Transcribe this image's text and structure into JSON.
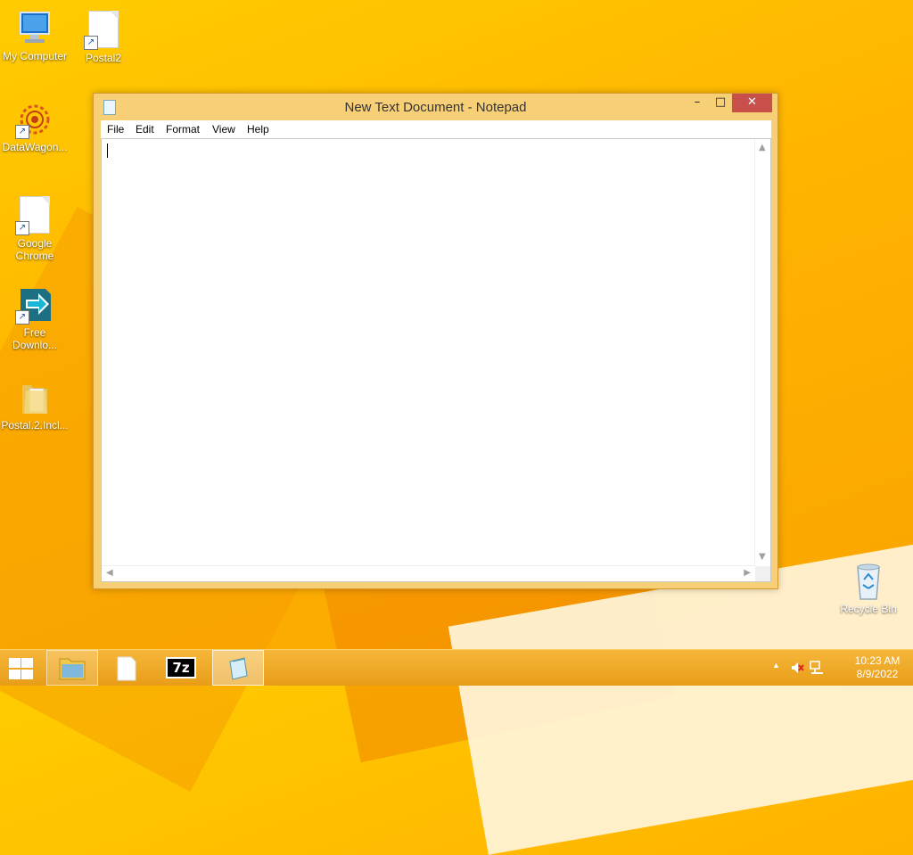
{
  "desktop": {
    "icons": [
      {
        "label": "My Computer",
        "icon": "computer-icon"
      },
      {
        "label": "Postal2",
        "icon": "document-icon"
      },
      {
        "label": "DataWagon...",
        "icon": "gear-emblem-icon"
      },
      {
        "label": "Google\nChrome",
        "icon": "document-icon"
      },
      {
        "label": "Free\nDownlo...",
        "icon": "download-arrow-icon"
      },
      {
        "label": "Postal.2.Incl...",
        "icon": "folder-icon"
      },
      {
        "label": "Recycle Bin",
        "icon": "recycle-bin-icon"
      }
    ]
  },
  "window": {
    "title": "New Text Document - Notepad",
    "controls": {
      "minimize": "–",
      "maximize": "□",
      "close": "✕"
    },
    "menu": [
      "File",
      "Edit",
      "Format",
      "View",
      "Help"
    ],
    "content": ""
  },
  "taskbar": {
    "items": [
      {
        "name": "file-explorer",
        "icon": "folder-icon"
      },
      {
        "name": "blank-document",
        "icon": "document-icon"
      },
      {
        "name": "7zip",
        "icon": "7z-icon",
        "label": "7z"
      },
      {
        "name": "notepad",
        "icon": "notepad-icon"
      }
    ],
    "tray": {
      "up_arrow": "▲",
      "time": "10:23 AM",
      "date": "8/9/2022"
    }
  },
  "colors": {
    "desktop_bg": "#ffbe1a",
    "window_frame": "#f7cf77",
    "close_button": "#c7504a",
    "taskbar": "#f0a728"
  }
}
